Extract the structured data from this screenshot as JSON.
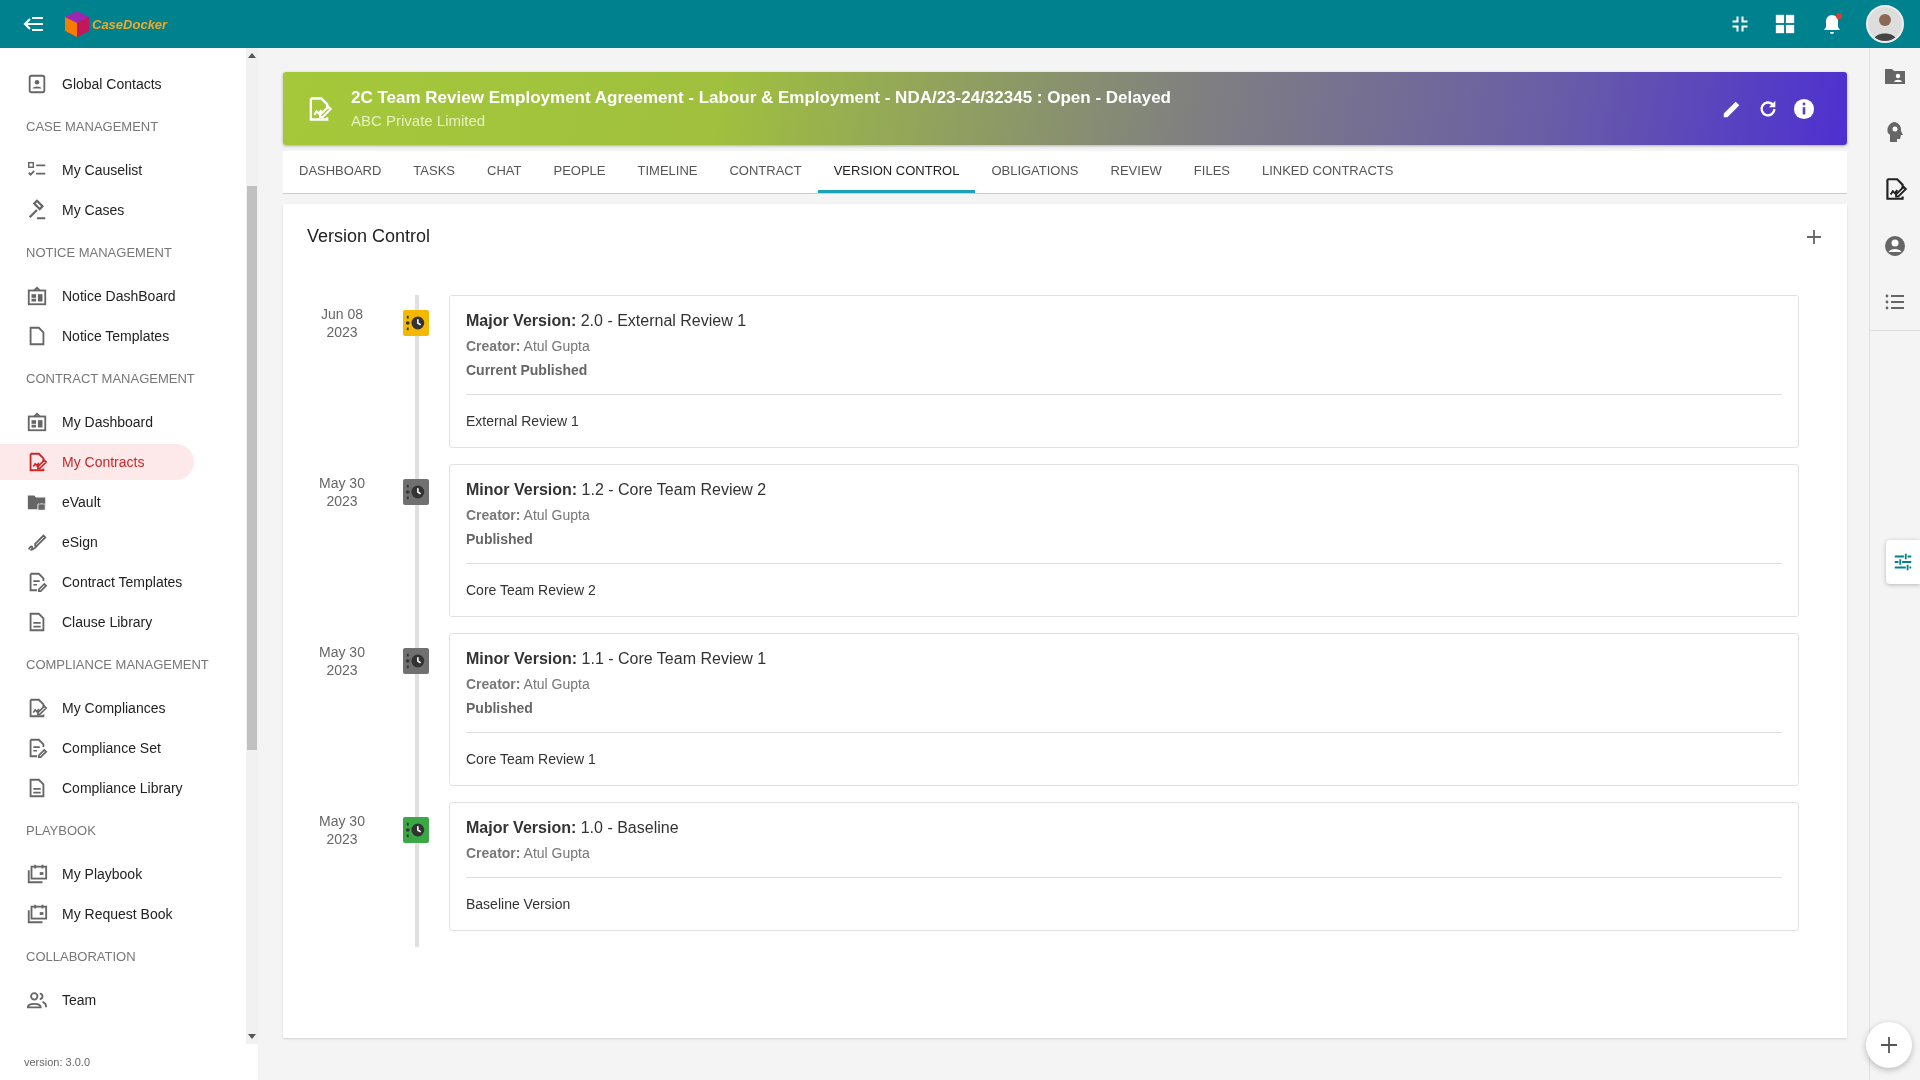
{
  "app": {
    "brand": "CaseDocker",
    "notifications_unread": true
  },
  "sidebar": {
    "items": [
      {
        "kind": "item",
        "label": "Global Contacts",
        "selected": false
      },
      {
        "kind": "header",
        "label": "CASE MANAGEMENT"
      },
      {
        "kind": "item",
        "label": "My Causelist",
        "selected": false
      },
      {
        "kind": "item",
        "label": "My Cases",
        "selected": false
      },
      {
        "kind": "header",
        "label": "NOTICE MANAGEMENT"
      },
      {
        "kind": "item",
        "label": "Notice DashBoard",
        "selected": false
      },
      {
        "kind": "item",
        "label": "Notice Templates",
        "selected": false
      },
      {
        "kind": "header",
        "label": "CONTRACT MANAGEMENT"
      },
      {
        "kind": "item",
        "label": "My Dashboard",
        "selected": false
      },
      {
        "kind": "item",
        "label": "My Contracts",
        "selected": true
      },
      {
        "kind": "item",
        "label": "eVault",
        "selected": false
      },
      {
        "kind": "item",
        "label": "eSign",
        "selected": false
      },
      {
        "kind": "item",
        "label": "Contract Templates",
        "selected": false
      },
      {
        "kind": "item",
        "label": "Clause Library",
        "selected": false
      },
      {
        "kind": "header",
        "label": "COMPLIANCE MANAGEMENT"
      },
      {
        "kind": "item",
        "label": "My Compliances",
        "selected": false
      },
      {
        "kind": "item",
        "label": "Compliance Set",
        "selected": false
      },
      {
        "kind": "item",
        "label": "Compliance Library",
        "selected": false
      },
      {
        "kind": "header",
        "label": "PLAYBOOK"
      },
      {
        "kind": "item",
        "label": "My Playbook",
        "selected": false
      },
      {
        "kind": "item",
        "label": "My Request Book",
        "selected": false
      },
      {
        "kind": "header",
        "label": "COLLABORATION"
      },
      {
        "kind": "item",
        "label": "Team",
        "selected": false
      }
    ],
    "version": "version: 3.0.0"
  },
  "case": {
    "title": "2C Team Review Employment Agreement - Labour & Employment - NDA/23-24/32345 : Open - Delayed",
    "client": "ABC Private Limited"
  },
  "tabs": [
    {
      "label": "DASHBOARD",
      "selected": false
    },
    {
      "label": "TASKS",
      "selected": false
    },
    {
      "label": "CHAT",
      "selected": false
    },
    {
      "label": "PEOPLE",
      "selected": false
    },
    {
      "label": "TIMELINE",
      "selected": false
    },
    {
      "label": "CONTRACT",
      "selected": false
    },
    {
      "label": "VERSION CONTROL",
      "selected": true
    },
    {
      "label": "OBLIGATIONS",
      "selected": false
    },
    {
      "label": "REVIEW",
      "selected": false
    },
    {
      "label": "FILES",
      "selected": false
    },
    {
      "label": "LINKED CONTRACTS",
      "selected": false
    }
  ],
  "version_control": {
    "title": "Version Control",
    "versions": [
      {
        "date": "Jun 08",
        "year": "2023",
        "color": "#f5b800",
        "heading": "**Major Version:** 2.0 - External Review 1",
        "creator": "**Creator:** Atul Gupta",
        "status": "Current Published",
        "description": "External Review 1"
      },
      {
        "date": "May 30",
        "year": "2023",
        "color": "#707070",
        "heading": "**Minor Version:** 1.2 - Core Team Review 2",
        "creator": "**Creator:** Atul Gupta",
        "status": "Published",
        "description": "Core Team Review 2"
      },
      {
        "date": "May 30",
        "year": "2023",
        "color": "#707070",
        "heading": "**Minor Version:** 1.1 - Core Team Review 1",
        "creator": "**Creator:** Atul Gupta",
        "status": "Published",
        "description": "Core Team Review 1"
      },
      {
        "date": "May 30",
        "year": "2023",
        "color": "#3aa845",
        "heading": "**Major Version:** 1.0 - Baseline",
        "creator": "**Creator:** Atul Gupta",
        "description": "Baseline Version"
      }
    ]
  }
}
